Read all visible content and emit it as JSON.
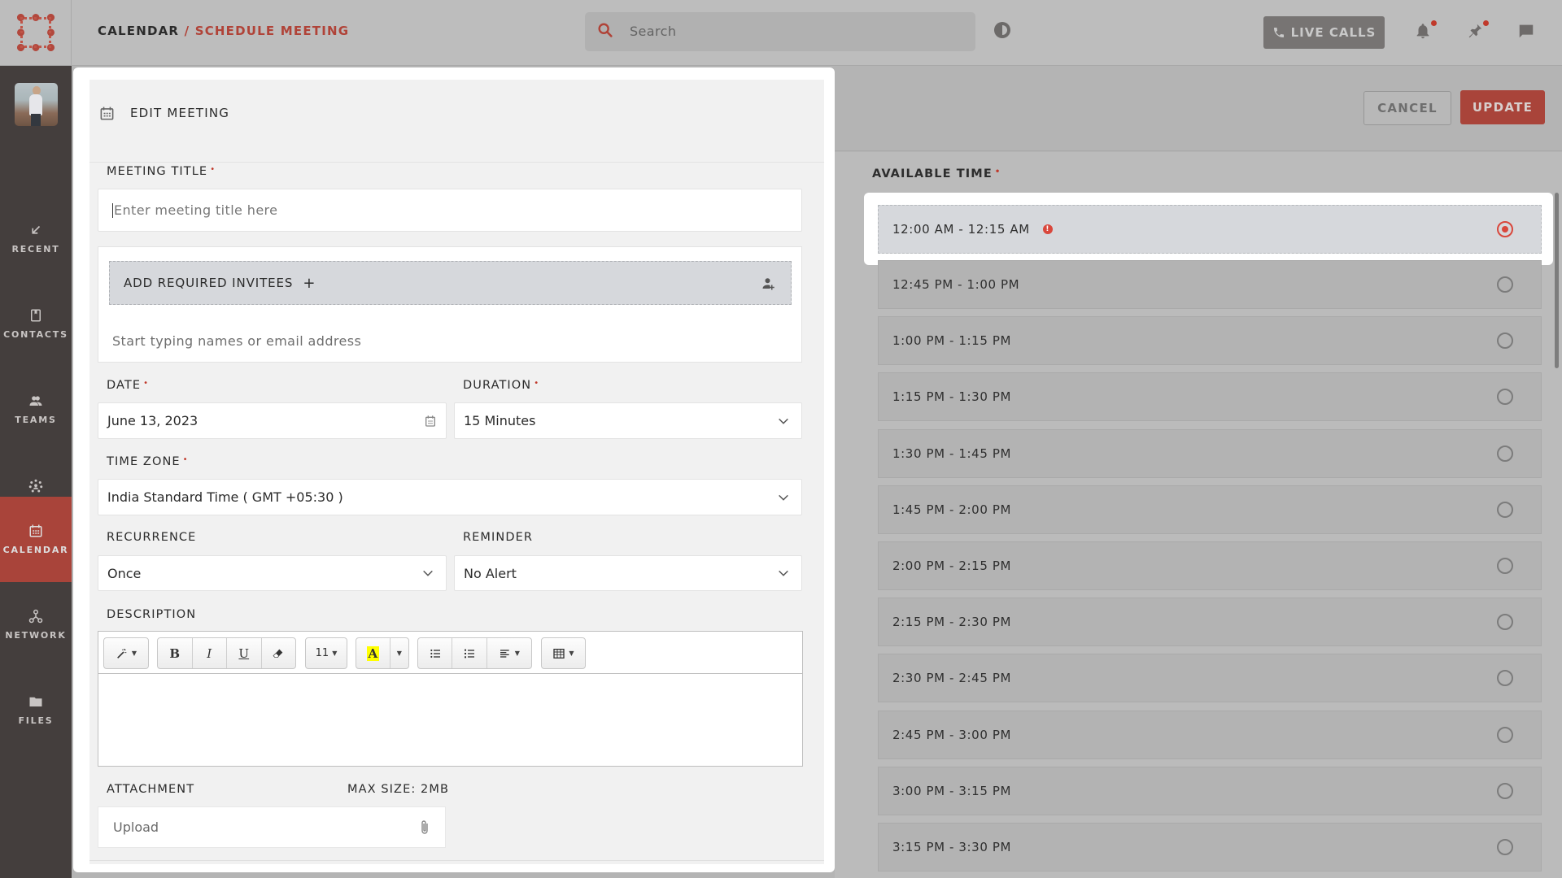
{
  "topbar": {
    "breadcrumb_root": "CALENDAR",
    "breadcrumb_sep": " / ",
    "breadcrumb_current": "SCHEDULE MEETING",
    "search_placeholder": "Search",
    "live_calls_label": "LIVE CALLS",
    "icons": [
      "search-icon",
      "theme-toggle-icon",
      "phone-icon",
      "bell-icon",
      "pin-icon",
      "chat-icon"
    ],
    "accent_color": "#b04338"
  },
  "sidebar": {
    "items": [
      {
        "label": "RECENT",
        "icon": "arrow-down-left-icon",
        "active": false
      },
      {
        "label": "CONTACTS",
        "icon": "contact-book-icon",
        "active": false
      },
      {
        "label": "TEAMS",
        "icon": "team-icon",
        "active": false
      },
      {
        "label": "GROUPS",
        "icon": "groups-icon",
        "active": false
      },
      {
        "label": "CALENDAR",
        "icon": "calendar-icon",
        "active": true
      },
      {
        "label": "NETWORK",
        "icon": "network-icon",
        "active": false
      },
      {
        "label": "FILES",
        "icon": "folder-icon",
        "active": false
      }
    ],
    "active_color": "#a9443a"
  },
  "form": {
    "title": "EDIT MEETING",
    "meeting_title": {
      "label": "MEETING TITLE",
      "required": "•",
      "placeholder": "Enter meeting title here",
      "value": ""
    },
    "invitees": {
      "button_label": "ADD REQUIRED INVITEES",
      "plus": "+",
      "placeholder": "Start typing names or email address"
    },
    "date": {
      "label": "DATE",
      "required": "•",
      "value": "June 13, 2023"
    },
    "duration": {
      "label": "DURATION",
      "required": "•",
      "value": "15 Minutes"
    },
    "timezone": {
      "label": "TIME ZONE",
      "required": "•",
      "value": "India Standard Time ( GMT +05:30 )"
    },
    "recurrence": {
      "label": "RECURRENCE",
      "value": "Once"
    },
    "reminder": {
      "label": "REMINDER",
      "value": "No Alert"
    },
    "description": {
      "label": "DESCRIPTION",
      "toolbar": {
        "bold": "B",
        "italic": "I",
        "underline": "U",
        "font_size": "11",
        "highlight": "A"
      },
      "value": ""
    },
    "attachment": {
      "label": "ATTACHMENT",
      "max_size": "MAX SIZE: 2MB",
      "placeholder": "Upload"
    }
  },
  "actions": {
    "cancel": "CANCEL",
    "update": "UPDATE"
  },
  "available_time": {
    "label": "AVAILABLE TIME",
    "required": "•",
    "slots": [
      {
        "label": "12:00 AM - 12:15 AM",
        "selected": true,
        "warning": true
      },
      {
        "label": "12:45 PM - 1:00 PM",
        "selected": false
      },
      {
        "label": "1:00 PM - 1:15 PM",
        "selected": false
      },
      {
        "label": "1:15 PM - 1:30 PM",
        "selected": false
      },
      {
        "label": "1:30 PM - 1:45 PM",
        "selected": false
      },
      {
        "label": "1:45 PM - 2:00 PM",
        "selected": false
      },
      {
        "label": "2:00 PM - 2:15 PM",
        "selected": false
      },
      {
        "label": "2:15 PM - 2:30 PM",
        "selected": false
      },
      {
        "label": "2:30 PM - 2:45 PM",
        "selected": false
      },
      {
        "label": "2:45 PM - 3:00 PM",
        "selected": false
      },
      {
        "label": "3:00 PM - 3:15 PM",
        "selected": false
      },
      {
        "label": "3:15 PM - 3:30 PM",
        "selected": false
      }
    ],
    "warning_glyph": "!"
  }
}
